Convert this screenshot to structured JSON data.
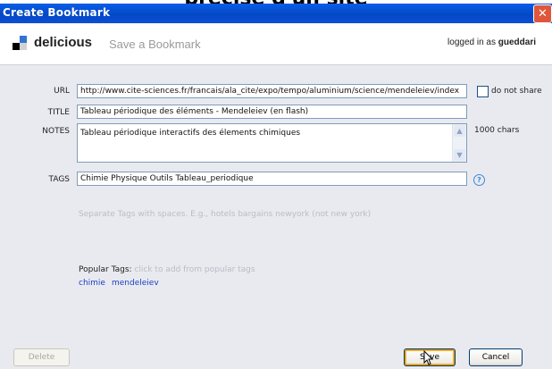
{
  "background_caption": "précise d'un site",
  "window": {
    "title": "Create Bookmark",
    "close_glyph": "✕"
  },
  "header": {
    "brand": "delicious",
    "subtitle": "Save a Bookmark",
    "logged_prefix": "logged in as",
    "username": "gueddari",
    "logo_colors": [
      "#3274d1",
      "#000000",
      "#d3d2d2",
      "#ffffff"
    ]
  },
  "form": {
    "url_label": "URL",
    "url_value": "http://www.cite-sciences.fr/francais/ala_cite/expo/tempo/aluminium/science/mendeleiev/index",
    "do_not_share_label": "do not share",
    "title_label": "TITLE",
    "title_value": "Tableau périodique des éléments - Mendeleiev (en flash)",
    "notes_label": "NOTES",
    "notes_value": "Tableau périodique interactifs des élements chimiques",
    "chars_label": "1000 chars",
    "tags_label": "TAGS",
    "tags_value": "Chimie Physique Outils Tableau_periodique",
    "help_glyph": "?",
    "tags_hint": "Separate Tags with spaces. E.g., hotels bargains newyork (not new york)"
  },
  "popular": {
    "label": "Popular Tags:",
    "hint": "click to add from popular tags",
    "tags": [
      "chimie",
      "mendeleiev"
    ]
  },
  "buttons": {
    "delete": "Delete",
    "save": "Save",
    "cancel": "Cancel"
  },
  "icons": [
    "close-icon",
    "delicious-logo-icon",
    "help-icon",
    "scroll-up-icon",
    "scroll-down-icon",
    "mouse-cursor-icon"
  ]
}
